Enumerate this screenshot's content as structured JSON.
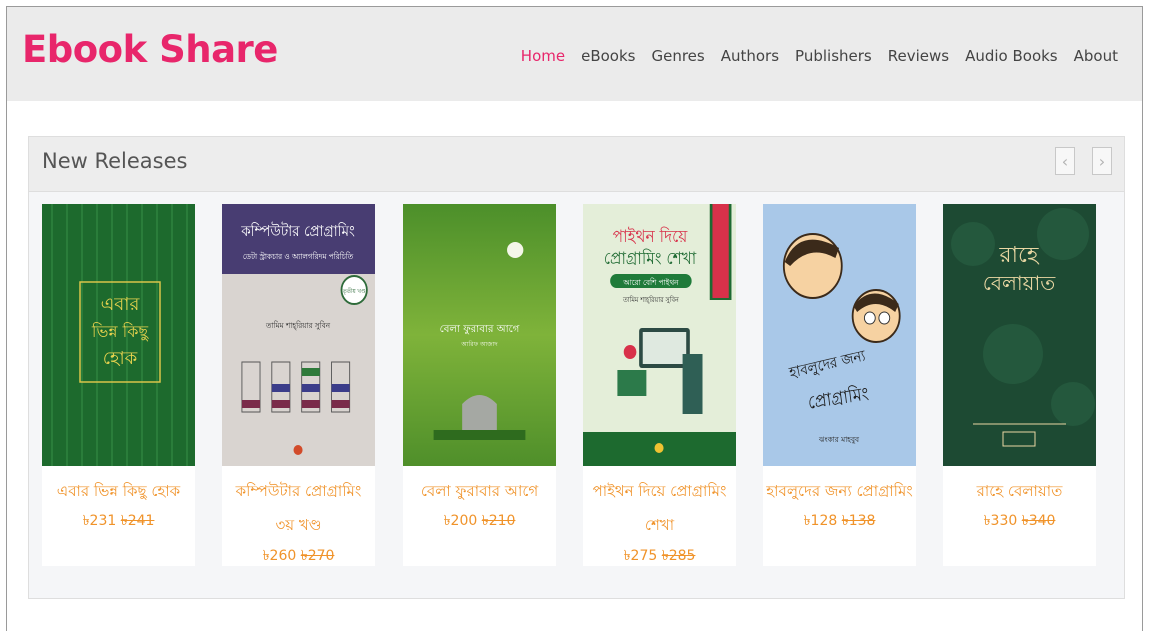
{
  "header": {
    "logo": "Ebook Share",
    "nav": [
      "Home",
      "eBooks",
      "Genres",
      "Authors",
      "Publishers",
      "Reviews",
      "Audio Books",
      "About"
    ],
    "active_nav": "Home",
    "brand_color": "#e8266b"
  },
  "section": {
    "title": "New Releases",
    "prev_icon": "chevron-left-icon",
    "next_icon": "chevron-right-icon"
  },
  "books": [
    {
      "title_line1": "এবার ভিন্ন কিছু হোক",
      "title_line2": "",
      "price": "৳231",
      "old_price": "৳241",
      "cover_text": [
        "এবার",
        "ভিন্ন কিছু",
        "হোক"
      ],
      "cover_color": "#1e6b2e"
    },
    {
      "title_line1": "কম্পিউটার প্রোগ্রামিং",
      "title_line2": "৩য় খণ্ড",
      "price": "৳260",
      "old_price": "৳270",
      "cover_text": [
        "কম্পিউটার প্রোগ্রামিং",
        "ডেটা স্ট্রাকচার ও অ্যালগরিদম পরিচিতি",
        "তৃতীয় খণ্ড",
        "তামিম শাহ্‌রিয়ার সুবিন"
      ],
      "cover_color": "#4a3e73"
    },
    {
      "title_line1": "বেলা ফুরাবার আগে",
      "title_line2": "",
      "price": "৳200",
      "old_price": "৳210",
      "cover_text": [
        "বেলা ফুরাবার আগে",
        "আরিফ আজাদ"
      ],
      "cover_color": "#5a9a2e"
    },
    {
      "title_line1": "পাইথন দিয়ে প্রোগ্রামিং",
      "title_line2": "শেখা",
      "price": "৳275",
      "old_price": "৳285",
      "cover_text": [
        "পাইথন দিয়ে",
        "প্রোগ্রামিং শেখা",
        "আরো বেশি পাইথন",
        "তামিম শাহ্‌রিয়ার সুবিন"
      ],
      "cover_color": "#e3efd6"
    },
    {
      "title_line1": "হাবলুদের জন্য প্রোগ্রামিং",
      "title_line2": "",
      "price": "৳128",
      "old_price": "৳138",
      "cover_text": [
        "হাবলুদের জন্য",
        "প্রোগ্রামিং",
        "ঝংকার মাহবুব"
      ],
      "cover_color": "#a7c7e8"
    },
    {
      "title_line1": "রাহে বেলায়াত",
      "title_line2": "",
      "price": "৳330",
      "old_price": "৳340",
      "cover_text": [
        "রাহে",
        "বেলায়াত"
      ],
      "cover_color": "#1c4a33"
    }
  ]
}
